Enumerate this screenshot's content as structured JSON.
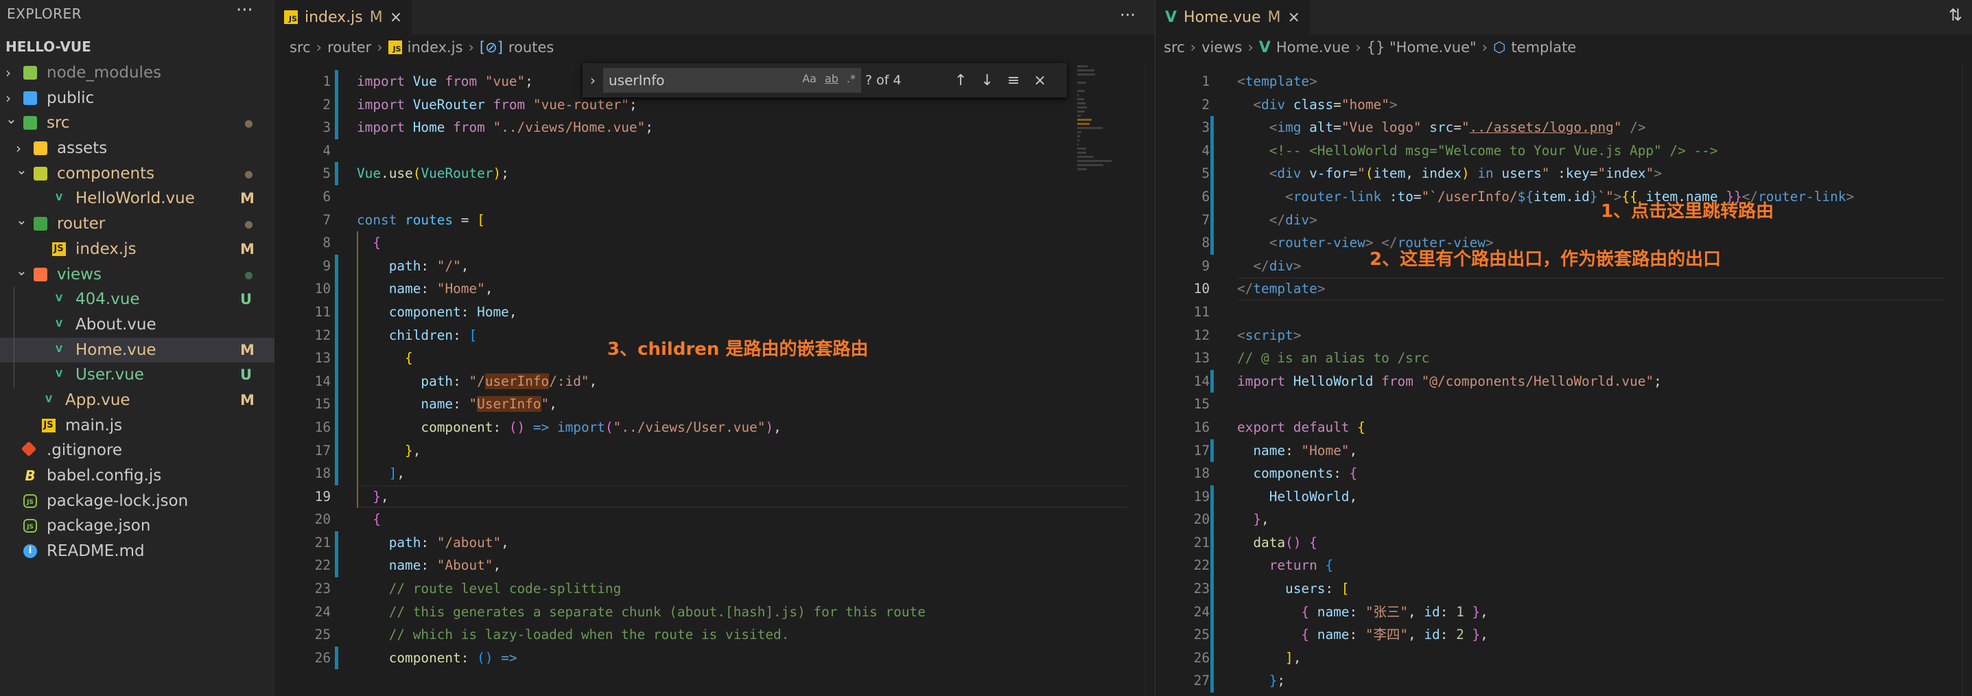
{
  "sidebar": {
    "title": "EXPLORER",
    "more": "···",
    "project": "HELLO-VUE",
    "items": [
      {
        "label": "node_modules",
        "depth": 0,
        "type": "folder",
        "open": false,
        "icon": "node-folder-icon",
        "iconColor": "#8bc34a",
        "color": "#8c8c8c"
      },
      {
        "label": "public",
        "depth": 0,
        "type": "folder",
        "open": false,
        "icon": "public-folder-icon",
        "iconColor": "#42a5f5",
        "color": "#cccccc"
      },
      {
        "label": "src",
        "depth": 0,
        "type": "folder",
        "open": true,
        "icon": "src-folder-icon",
        "iconColor": "#4caf50",
        "color": "#e2c08d",
        "dot": "#7d6a55"
      },
      {
        "label": "assets",
        "depth": 1,
        "type": "folder",
        "open": false,
        "icon": "assets-folder-icon",
        "iconColor": "#fbc02d",
        "color": "#cccccc"
      },
      {
        "label": "components",
        "depth": 1,
        "type": "folder",
        "open": true,
        "icon": "components-folder-icon",
        "iconColor": "#c0ca33",
        "color": "#e2c08d",
        "dot": "#7d6a55"
      },
      {
        "label": "HelloWorld.vue",
        "depth": 2,
        "type": "vue",
        "color": "#e2c08d",
        "badge": "M"
      },
      {
        "label": "router",
        "depth": 1,
        "type": "folder",
        "open": true,
        "icon": "router-folder-icon",
        "iconColor": "#43a047",
        "color": "#e2c08d",
        "dot": "#7d6a55"
      },
      {
        "label": "index.js",
        "depth": 2,
        "type": "js",
        "color": "#e2c08d",
        "badge": "M"
      },
      {
        "label": "views",
        "depth": 1,
        "type": "folder",
        "open": true,
        "icon": "views-folder-icon",
        "iconColor": "#ff7043",
        "color": "#73c991",
        "dot": "#3f6b4f"
      },
      {
        "label": "404.vue",
        "depth": 2,
        "type": "vue",
        "color": "#73c991",
        "badge": "U"
      },
      {
        "label": "About.vue",
        "depth": 2,
        "type": "vue",
        "color": "#cccccc"
      },
      {
        "label": "Home.vue",
        "depth": 2,
        "type": "vue",
        "color": "#e2c08d",
        "badge": "M",
        "selected": true
      },
      {
        "label": "User.vue",
        "depth": 2,
        "type": "vue",
        "color": "#73c991",
        "badge": "U"
      },
      {
        "label": "App.vue",
        "depth": 1,
        "type": "vue",
        "color": "#e2c08d",
        "badge": "M"
      },
      {
        "label": "main.js",
        "depth": 1,
        "type": "js",
        "color": "#cccccc"
      },
      {
        "label": ".gitignore",
        "depth": 0,
        "type": "git",
        "color": "#cccccc"
      },
      {
        "label": "babel.config.js",
        "depth": 0,
        "type": "babel",
        "color": "#cccccc"
      },
      {
        "label": "package-lock.json",
        "depth": 0,
        "type": "node",
        "color": "#cccccc"
      },
      {
        "label": "package.json",
        "depth": 0,
        "type": "node",
        "color": "#cccccc"
      },
      {
        "label": "README.md",
        "depth": 0,
        "type": "info",
        "color": "#cccccc"
      }
    ]
  },
  "badgeColors": {
    "M": "#e2c08d",
    "U": "#73c991"
  },
  "left": {
    "tab": {
      "name": "index.js",
      "mod": "M",
      "close": "×"
    },
    "more": "···",
    "breadcrumb": [
      "src",
      "router",
      "index.js",
      "routes"
    ],
    "find": {
      "value": "userInfo",
      "opts": [
        "Aa",
        "ab",
        ".*"
      ],
      "count": "? of 4",
      "prev": "↑",
      "next": "↓",
      "sel": "≡",
      "close": "×",
      "toggle": "›"
    },
    "current": 19,
    "git": [
      1,
      2,
      3,
      5,
      9,
      10,
      11,
      12,
      13,
      14,
      15,
      16,
      17,
      18,
      21,
      22,
      26
    ],
    "lines": [
      [
        [
          "import",
          "k"
        ],
        [
          " "
        ],
        [
          "Vue",
          "v"
        ],
        [
          " "
        ],
        [
          "from",
          "k"
        ],
        [
          " "
        ],
        [
          "\"vue\"",
          "s"
        ],
        [
          ";",
          "p"
        ]
      ],
      [
        [
          "import",
          "k"
        ],
        [
          " "
        ],
        [
          "VueRouter",
          "v"
        ],
        [
          " "
        ],
        [
          "from",
          "k"
        ],
        [
          " "
        ],
        [
          "\"vue-router\"",
          "s"
        ],
        [
          ";",
          "p"
        ]
      ],
      [
        [
          "import",
          "k"
        ],
        [
          " "
        ],
        [
          "Home",
          "v"
        ],
        [
          " "
        ],
        [
          "from",
          "k"
        ],
        [
          " "
        ],
        [
          "\"../views/Home.vue\"",
          "s"
        ],
        [
          ";",
          "p"
        ]
      ],
      [],
      [
        [
          "Vue",
          "n"
        ],
        [
          ".",
          "p"
        ],
        [
          "use",
          "f"
        ],
        [
          "(",
          "b1"
        ],
        [
          "VueRouter",
          "n"
        ],
        [
          ")",
          "b1"
        ],
        [
          ";",
          "p"
        ]
      ],
      [],
      [
        [
          "const",
          "t"
        ],
        [
          " "
        ],
        [
          "routes",
          "vb"
        ],
        [
          " = ",
          "p"
        ],
        [
          "[",
          "b1"
        ]
      ],
      [
        [
          "  "
        ],
        [
          "{",
          "b2"
        ]
      ],
      [
        [
          "    "
        ],
        [
          "path",
          "v"
        ],
        [
          ": ",
          "p"
        ],
        [
          "\"/\"",
          "s"
        ],
        [
          ",",
          "p"
        ]
      ],
      [
        [
          "    "
        ],
        [
          "name",
          "v"
        ],
        [
          ": ",
          "p"
        ],
        [
          "\"Home\"",
          "s"
        ],
        [
          ",",
          "p"
        ]
      ],
      [
        [
          "    "
        ],
        [
          "component",
          "v"
        ],
        [
          ": ",
          "p"
        ],
        [
          "Home",
          "v"
        ],
        [
          ",",
          "p"
        ]
      ],
      [
        [
          "    "
        ],
        [
          "children",
          "v"
        ],
        [
          ": ",
          "p"
        ],
        [
          "[",
          "b3"
        ]
      ],
      [
        [
          "      "
        ],
        [
          "{",
          "b1"
        ]
      ],
      [
        [
          "        "
        ],
        [
          "path",
          "v"
        ],
        [
          ": ",
          "p"
        ],
        [
          "\"/",
          "s"
        ],
        [
          "userInfo",
          "m"
        ],
        [
          "/:id\"",
          "s"
        ],
        [
          ",",
          "p"
        ]
      ],
      [
        [
          "        "
        ],
        [
          "name",
          "v"
        ],
        [
          ": ",
          "p"
        ],
        [
          "\"",
          "s"
        ],
        [
          "UserInfo",
          "m"
        ],
        [
          "\"",
          "s"
        ],
        [
          ",",
          "p"
        ]
      ],
      [
        [
          "        "
        ],
        [
          "component",
          "f"
        ],
        [
          ": ",
          "p"
        ],
        [
          "()",
          "b2"
        ],
        [
          " "
        ],
        [
          "=>",
          "t"
        ],
        [
          " "
        ],
        [
          "import",
          "t"
        ],
        [
          "(",
          "b2"
        ],
        [
          "\"../views/User.vue\"",
          "s"
        ],
        [
          ")",
          "b2"
        ],
        [
          ",",
          "p"
        ]
      ],
      [
        [
          "      "
        ],
        [
          "}",
          "b1"
        ],
        [
          ",",
          "p"
        ]
      ],
      [
        [
          "    "
        ],
        [
          "]",
          "b3"
        ],
        [
          ",",
          "p"
        ]
      ],
      [
        [
          "  "
        ],
        [
          "}",
          "b2"
        ],
        [
          ",",
          "p"
        ]
      ],
      [
        [
          "  "
        ],
        [
          "{",
          "b2"
        ]
      ],
      [
        [
          "    "
        ],
        [
          "path",
          "v"
        ],
        [
          ": ",
          "p"
        ],
        [
          "\"/about\"",
          "s"
        ],
        [
          ",",
          "p"
        ]
      ],
      [
        [
          "    "
        ],
        [
          "name",
          "v"
        ],
        [
          ": ",
          "p"
        ],
        [
          "\"About\"",
          "s"
        ],
        [
          ",",
          "p"
        ]
      ],
      [
        [
          "    "
        ],
        [
          "// route level code-splitting",
          "c"
        ]
      ],
      [
        [
          "    "
        ],
        [
          "// this generates a separate chunk (about.[hash].js) for this route",
          "c"
        ]
      ],
      [
        [
          "    "
        ],
        [
          "// which is lazy-loaded when the route is visited.",
          "c"
        ]
      ],
      [
        [
          "    "
        ],
        [
          "component",
          "f"
        ],
        [
          ": ",
          "p"
        ],
        [
          "()",
          "b3"
        ],
        [
          " "
        ],
        [
          "=>",
          "t"
        ]
      ]
    ]
  },
  "right": {
    "tab": {
      "name": "Home.vue",
      "mod": "M",
      "close": "×"
    },
    "breadcrumb": [
      "src",
      "views",
      "Home.vue",
      "{} \"Home.vue\"",
      "template"
    ],
    "current": 10,
    "git": [
      3,
      4,
      5,
      6,
      7,
      8,
      14,
      17,
      19,
      20,
      21,
      22,
      23,
      24,
      25,
      26,
      27
    ],
    "lines": [
      [
        [
          "<",
          "g"
        ],
        [
          "template",
          "t"
        ],
        [
          ">",
          "g"
        ]
      ],
      [
        [
          "  "
        ],
        [
          "<",
          "g"
        ],
        [
          "div",
          "t"
        ],
        [
          " "
        ],
        [
          "class",
          "v"
        ],
        [
          "=",
          "p"
        ],
        [
          "\"home\"",
          "s"
        ],
        [
          ">",
          "g"
        ]
      ],
      [
        [
          "    "
        ],
        [
          "<",
          "g"
        ],
        [
          "img",
          "t"
        ],
        [
          " "
        ],
        [
          "alt",
          "v"
        ],
        [
          "=",
          "p"
        ],
        [
          "\"Vue logo\"",
          "s"
        ],
        [
          " "
        ],
        [
          "src",
          "v"
        ],
        [
          "=",
          "p"
        ],
        [
          "\"",
          "s"
        ],
        [
          "../assets/logo.png",
          "u"
        ],
        [
          "\"",
          "s"
        ],
        [
          " "
        ],
        [
          "/>",
          "g"
        ]
      ],
      [
        [
          "    "
        ],
        [
          "<!-- <HelloWorld msg=\"Welcome to Your Vue.js App\" /> -->",
          "c"
        ]
      ],
      [
        [
          "    "
        ],
        [
          "<",
          "g"
        ],
        [
          "div",
          "t"
        ],
        [
          " "
        ],
        [
          "v-for",
          "v"
        ],
        [
          "=",
          "p"
        ],
        [
          "\"",
          "s"
        ],
        [
          "(",
          "b1"
        ],
        [
          "item",
          "v"
        ],
        [
          ", ",
          "p"
        ],
        [
          "index",
          "v"
        ],
        [
          ")",
          "b1"
        ],
        [
          " "
        ],
        [
          "in",
          "t"
        ],
        [
          " "
        ],
        [
          "users",
          "v"
        ],
        [
          "\"",
          "s"
        ],
        [
          " "
        ],
        [
          ":key",
          "v"
        ],
        [
          "=",
          "p"
        ],
        [
          "\"",
          "s"
        ],
        [
          "index",
          "v"
        ],
        [
          "\"",
          "s"
        ],
        [
          ">",
          "g"
        ]
      ],
      [
        [
          "      "
        ],
        [
          "<",
          "g"
        ],
        [
          "router-link",
          "t"
        ],
        [
          " "
        ],
        [
          ":to",
          "v"
        ],
        [
          "=",
          "p"
        ],
        [
          "\"`/userInfo/",
          "s"
        ],
        [
          "${",
          "t"
        ],
        [
          "item",
          "v"
        ],
        [
          ".",
          "p"
        ],
        [
          "id",
          "v"
        ],
        [
          "}",
          "t"
        ],
        [
          "`\"",
          "s"
        ],
        [
          ">",
          "g"
        ],
        [
          "{{",
          "b1"
        ],
        [
          " item",
          "v"
        ],
        [
          ".",
          "p"
        ],
        [
          "name",
          "v"
        ],
        [
          " "
        ],
        [
          "}}",
          "b2"
        ],
        [
          "</",
          "g"
        ],
        [
          "router-link",
          "t"
        ],
        [
          ">",
          "g"
        ]
      ],
      [
        [
          "    "
        ],
        [
          "</",
          "g"
        ],
        [
          "div",
          "t"
        ],
        [
          ">",
          "g"
        ]
      ],
      [
        [
          "    "
        ],
        [
          "<",
          "g"
        ],
        [
          "router-view",
          "t"
        ],
        [
          ">",
          "g"
        ],
        [
          " "
        ],
        [
          "</",
          "g"
        ],
        [
          "router-view",
          "t"
        ],
        [
          ">",
          "g"
        ]
      ],
      [
        [
          "  "
        ],
        [
          "</",
          "g"
        ],
        [
          "div",
          "t"
        ],
        [
          ">",
          "g"
        ]
      ],
      [
        [
          "</",
          "g"
        ],
        [
          "template",
          "t"
        ],
        [
          ">",
          "g"
        ]
      ],
      [],
      [
        [
          "<",
          "g"
        ],
        [
          "script",
          "t"
        ],
        [
          ">",
          "g"
        ]
      ],
      [
        [
          "// @ is an alias to /src",
          "c"
        ]
      ],
      [
        [
          "import",
          "k"
        ],
        [
          " "
        ],
        [
          "HelloWorld",
          "v"
        ],
        [
          " "
        ],
        [
          "from",
          "k"
        ],
        [
          " "
        ],
        [
          "\"@/components/HelloWorld.vue\"",
          "s"
        ],
        [
          ";",
          "p"
        ]
      ],
      [],
      [
        [
          "export",
          "k"
        ],
        [
          " "
        ],
        [
          "default",
          "k"
        ],
        [
          " "
        ],
        [
          "{",
          "b1"
        ]
      ],
      [
        [
          "  "
        ],
        [
          "name",
          "v"
        ],
        [
          ": ",
          "p"
        ],
        [
          "\"Home\"",
          "s"
        ],
        [
          ",",
          "p"
        ]
      ],
      [
        [
          "  "
        ],
        [
          "components",
          "v"
        ],
        [
          ": ",
          "p"
        ],
        [
          "{",
          "b2"
        ]
      ],
      [
        [
          "    "
        ],
        [
          "HelloWorld",
          "v"
        ],
        [
          ",",
          "p"
        ]
      ],
      [
        [
          "  "
        ],
        [
          "}",
          "b2"
        ],
        [
          ",",
          "p"
        ]
      ],
      [
        [
          "  "
        ],
        [
          "data",
          "f"
        ],
        [
          "()",
          "b2"
        ],
        [
          " "
        ],
        [
          "{",
          "b2"
        ]
      ],
      [
        [
          "    "
        ],
        [
          "return",
          "k"
        ],
        [
          " "
        ],
        [
          "{",
          "b3"
        ]
      ],
      [
        [
          "      "
        ],
        [
          "users",
          "v"
        ],
        [
          ": ",
          "p"
        ],
        [
          "[",
          "b1"
        ]
      ],
      [
        [
          "        "
        ],
        [
          "{",
          "b2"
        ],
        [
          " "
        ],
        [
          "name",
          "v"
        ],
        [
          ": ",
          "p"
        ],
        [
          "\"张三\"",
          "s"
        ],
        [
          ", ",
          "p"
        ],
        [
          "id",
          "v"
        ],
        [
          ": ",
          "p"
        ],
        [
          "1",
          "num"
        ],
        [
          " "
        ],
        [
          "}",
          "b2"
        ],
        [
          ",",
          "p"
        ]
      ],
      [
        [
          "        "
        ],
        [
          "{",
          "b2"
        ],
        [
          " "
        ],
        [
          "name",
          "v"
        ],
        [
          ": ",
          "p"
        ],
        [
          "\"李四\"",
          "s"
        ],
        [
          ", ",
          "p"
        ],
        [
          "id",
          "v"
        ],
        [
          ": ",
          "p"
        ],
        [
          "2",
          "num"
        ],
        [
          " "
        ],
        [
          "}",
          "b2"
        ],
        [
          ",",
          "p"
        ]
      ],
      [
        [
          "      "
        ],
        [
          "]",
          "b1"
        ],
        [
          ",",
          "p"
        ]
      ],
      [
        [
          "    "
        ],
        [
          "}",
          "b3"
        ],
        [
          ";",
          "p"
        ]
      ]
    ]
  },
  "annotations": {
    "a1": "1、点击这里跳转路由",
    "a2": "2、这里有个路由出口，作为嵌套路由的出口",
    "a3": "3、children 是路由的嵌套路由",
    "color": "#f5792a"
  }
}
